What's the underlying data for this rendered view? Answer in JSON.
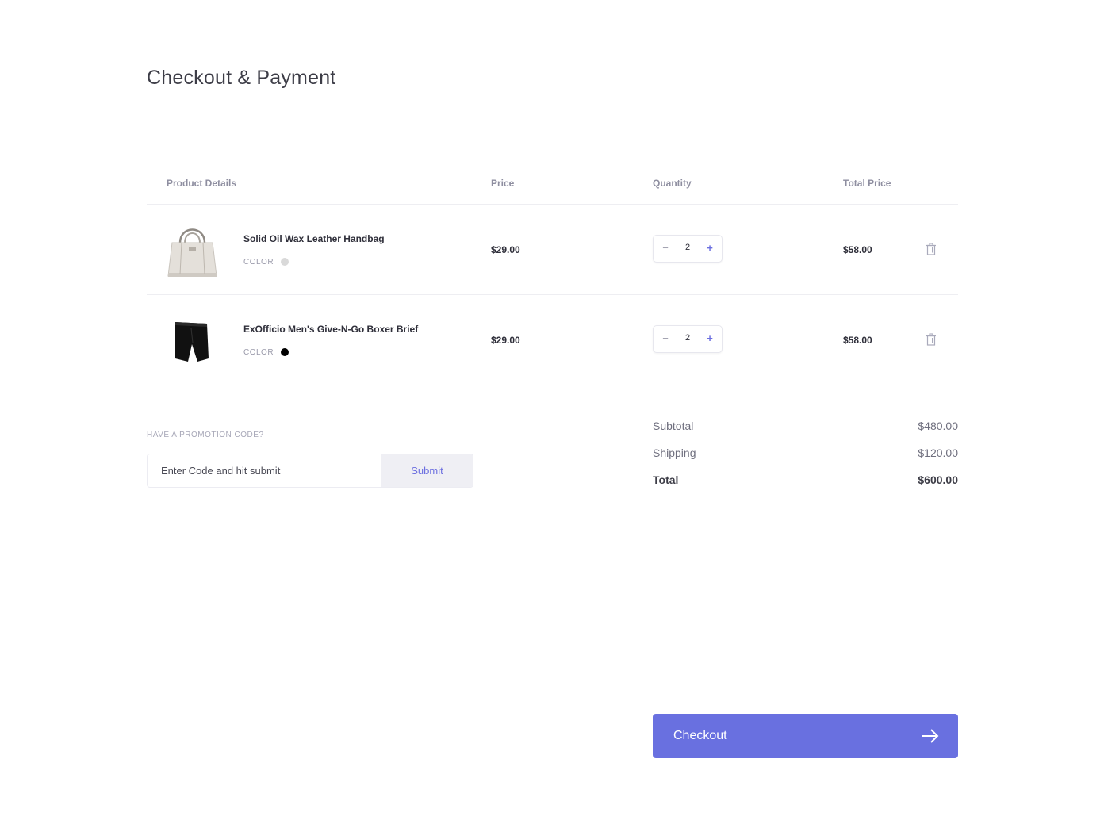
{
  "page": {
    "title": "Checkout & Payment"
  },
  "cart": {
    "columns": {
      "product": "Product Details",
      "price": "Price",
      "quantity": "Quantity",
      "total": "Total Price"
    },
    "items": [
      {
        "name": "Solid Oil Wax Leather Handbag",
        "color_label": "COLOR",
        "color": "#d9d9d9",
        "image_icon": "handbag-image",
        "price": "$29.00",
        "quantity": "2",
        "total": "$58.00"
      },
      {
        "name": "ExOfficio Men's Give-N-Go Boxer Brief",
        "color_label": "COLOR",
        "color": "#000000",
        "image_icon": "boxer-brief-image",
        "price": "$29.00",
        "quantity": "2",
        "total": "$58.00"
      }
    ],
    "qty_minus": "−",
    "qty_plus": "+",
    "delete_icon": "trash-icon"
  },
  "promo": {
    "label": "HAVE A PROMOTION CODE?",
    "placeholder": "Enter Code and hit submit",
    "submit_label": "Submit"
  },
  "summary": {
    "subtotal_label": "Subtotal",
    "subtotal_value": "$480.00",
    "shipping_label": "Shipping",
    "shipping_value": "$120.00",
    "total_label": "Total",
    "total_value": "$600.00"
  },
  "checkout": {
    "label": "Checkout",
    "icon": "arrow-right-icon"
  },
  "colors": {
    "accent": "#6970e0",
    "text": "#2f2f3a",
    "muted": "#8e8ea0"
  }
}
